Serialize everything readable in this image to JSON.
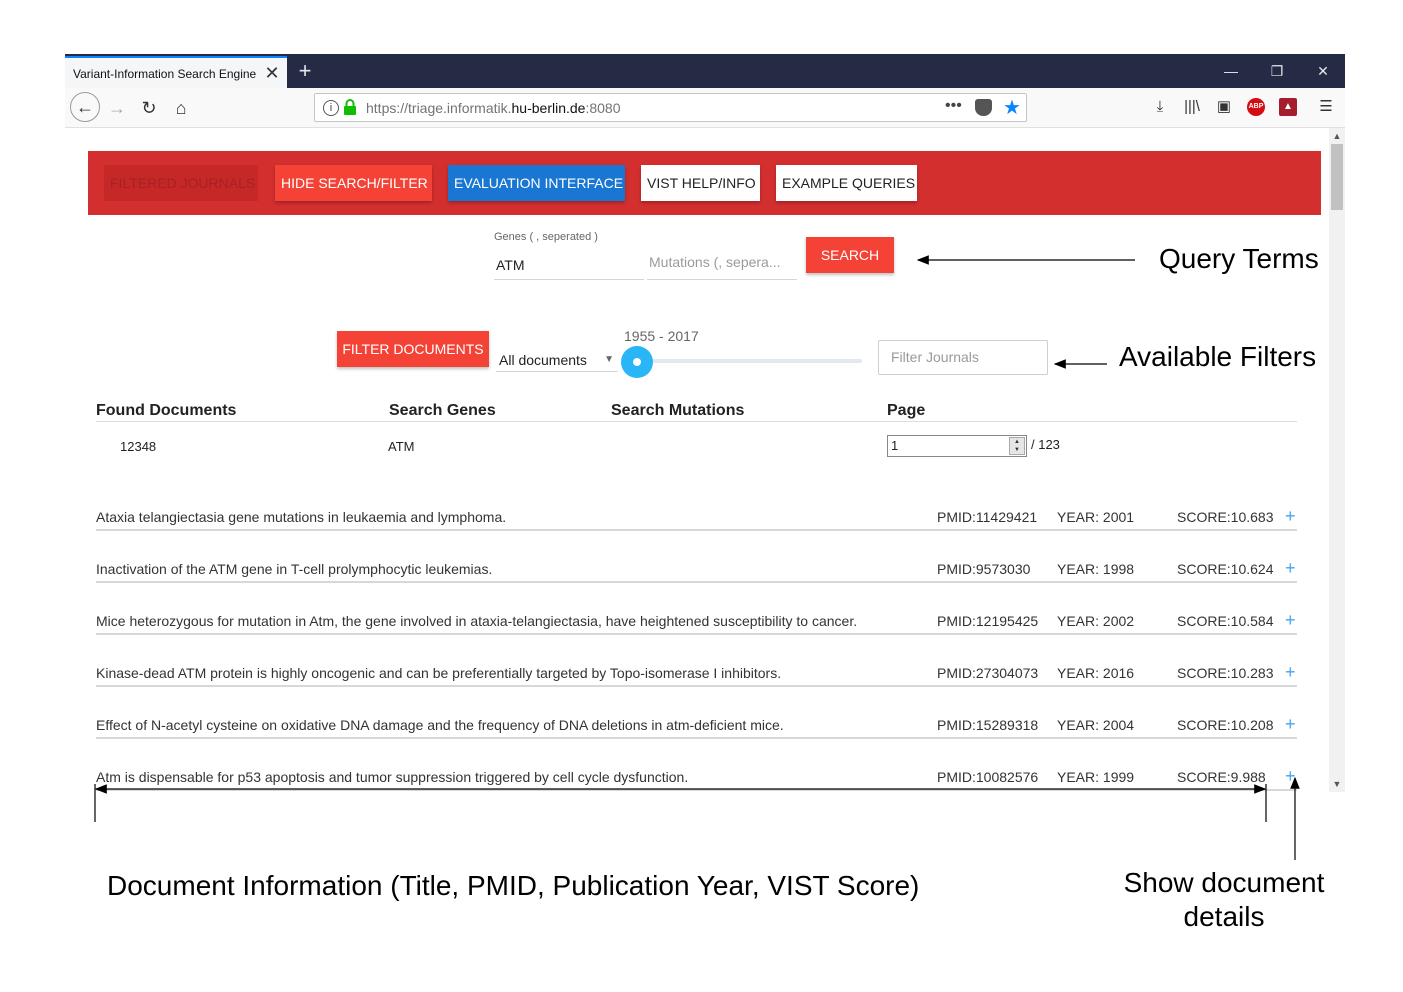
{
  "browser": {
    "tab_title": "Variant-Information Search Engine",
    "url_prefix": "https://triage.informatik.",
    "url_host": "hu-berlin.de",
    "url_suffix": ":8080"
  },
  "toolbar": {
    "filtered_journals": "FILTERED JOURNALS",
    "hide_search": "HIDE SEARCH/FILTER",
    "evaluation": "EVALUATION INTERFACE",
    "help": "VIST HELP/INFO",
    "examples": "EXAMPLE QUERIES"
  },
  "query": {
    "genes_label": "Genes ( , seperated )",
    "genes_value": "ATM",
    "mutations_placeholder": "Mutations (, sepera...",
    "search_label": "SEARCH"
  },
  "filters": {
    "filter_docs_label": "FILTER DOCUMENTS",
    "doc_type": "All documents",
    "year_range": "1955 - 2017",
    "journal_placeholder": "Filter Journals"
  },
  "summary": {
    "headers": {
      "found": "Found Documents",
      "genes": "Search Genes",
      "mutations": "Search Mutations",
      "page": "Page"
    },
    "found_count": "12348",
    "genes": "ATM",
    "mutations": "",
    "page": "1",
    "page_total": "/ 123"
  },
  "documents": [
    {
      "title": "Ataxia telangiectasia gene mutations in leukaemia and lymphoma.",
      "pmid": "PMID:11429421",
      "year": "YEAR: 2001",
      "score": "SCORE:10.683"
    },
    {
      "title": "Inactivation of the ATM gene in T-cell prolymphocytic leukemias.",
      "pmid": "PMID:9573030",
      "year": "YEAR: 1998",
      "score": "SCORE:10.624"
    },
    {
      "title": "Mice heterozygous for mutation in Atm, the gene involved in ataxia-telangiectasia, have heightened susceptibility to cancer.",
      "pmid": "PMID:12195425",
      "year": "YEAR: 2002",
      "score": "SCORE:10.584"
    },
    {
      "title": "Kinase-dead ATM protein is highly oncogenic and can be preferentially targeted by Topo-isomerase I inhibitors.",
      "pmid": "PMID:27304073",
      "year": "YEAR: 2016",
      "score": "SCORE:10.283"
    },
    {
      "title": "Effect of N-acetyl cysteine on oxidative DNA damage and the frequency of DNA deletions in atm-deficient mice.",
      "pmid": "PMID:15289318",
      "year": "YEAR: 2004",
      "score": "SCORE:10.208"
    },
    {
      "title": "Atm is dispensable for p53 apoptosis and tumor suppression triggered by cell cycle dysfunction.",
      "pmid": "PMID:10082576",
      "year": "YEAR: 1999",
      "score": "SCORE:9.988"
    }
  ],
  "annotations": {
    "query_terms": "Query Terms",
    "available_filters": "Available Filters",
    "document_info": "Document Information (Title, PMID, Publication Year, VIST Score)",
    "show_details_1": "Show document",
    "show_details_2": "details"
  },
  "colors": {
    "topbar": "#d32f2f",
    "primary_button": "#f44336",
    "evaluation_button": "#1976d2",
    "slider": "#29b6f6",
    "plus_icon": "#42a5f5"
  }
}
